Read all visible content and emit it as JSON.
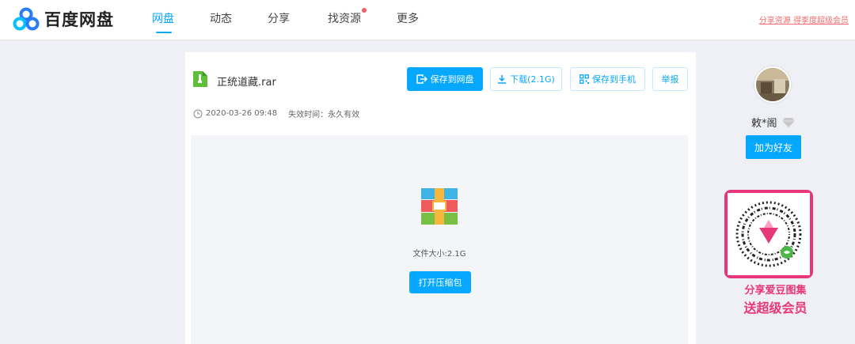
{
  "app": {
    "name": "百度网盘"
  },
  "nav": [
    {
      "label": "网盘",
      "active": true
    },
    {
      "label": "动态",
      "active": false
    },
    {
      "label": "分享",
      "active": false
    },
    {
      "label": "找资源",
      "active": false,
      "badge_dot": true
    },
    {
      "label": "更多",
      "active": false
    }
  ],
  "top_link": "分享资源 得季度超级会员",
  "file": {
    "name": "正统道藏.rar",
    "date": "2020-03-26 09:48",
    "expiry": "失效时间：永久有效",
    "size_text": "文件大小:2.1G"
  },
  "actions": {
    "save_to_disk": "保存到网盘",
    "download": "下载(2.1G)",
    "save_to_phone": "保存到手机",
    "report": "举报",
    "open_archive": "打开压缩包"
  },
  "sharer": {
    "name": "敕*阁",
    "add_friend": "加为好友"
  },
  "promo": {
    "line1": "分享爱豆图集",
    "line2": "送超级会员"
  },
  "colors": {
    "accent": "#06a7ff",
    "promo": "#e8367a",
    "badge": "#f25d5d"
  }
}
